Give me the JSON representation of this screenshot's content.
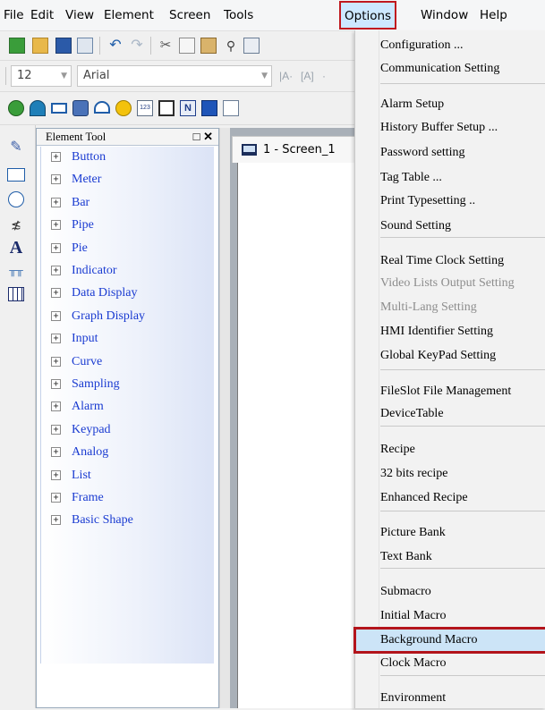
{
  "menubar": {
    "items": [
      "File",
      "Edit",
      "View",
      "Element",
      "Screen",
      "Tools",
      "Options",
      "Window",
      "Help"
    ],
    "active": "Options",
    "highlight_color": "#c0191f"
  },
  "format_toolbar": {
    "font_size": "12",
    "font_name": "Arial"
  },
  "element_tool": {
    "title": "Element Tool",
    "items": [
      "Button",
      "Meter",
      "Bar",
      "Pipe",
      "Pie",
      "Indicator",
      "Data Display",
      "Graph Display",
      "Input",
      "Curve",
      "Sampling",
      "Alarm",
      "Keypad",
      "Analog",
      "List",
      "Frame",
      "Basic Shape"
    ],
    "expander": "+",
    "text_color": "#1a3bd1"
  },
  "document": {
    "tab_label": "1 - Screen_1"
  },
  "options_menu": {
    "items": [
      "Configuration ...",
      "Communication Setting",
      "Alarm Setup",
      "History Buffer Setup ...",
      "Password setting",
      "Tag Table ...",
      "Print Typesetting ..",
      "Sound Setting",
      "Real Time Clock Setting",
      "Video Lists Output Setting",
      "Multi-Lang Setting",
      "HMI Identifier Setting",
      "Global KeyPad Setting",
      "FileSlot File Management",
      "DeviceTable",
      "Recipe",
      "32 bits recipe",
      "Enhanced Recipe",
      "Picture Bank",
      "Text Bank",
      "Submacro",
      "Initial Macro",
      "Background Macro",
      "Clock Macro",
      "Environment"
    ],
    "disabled": [
      "Video Lists Output Setting",
      "Multi-Lang Setting"
    ],
    "highlighted": "Background Macro"
  }
}
